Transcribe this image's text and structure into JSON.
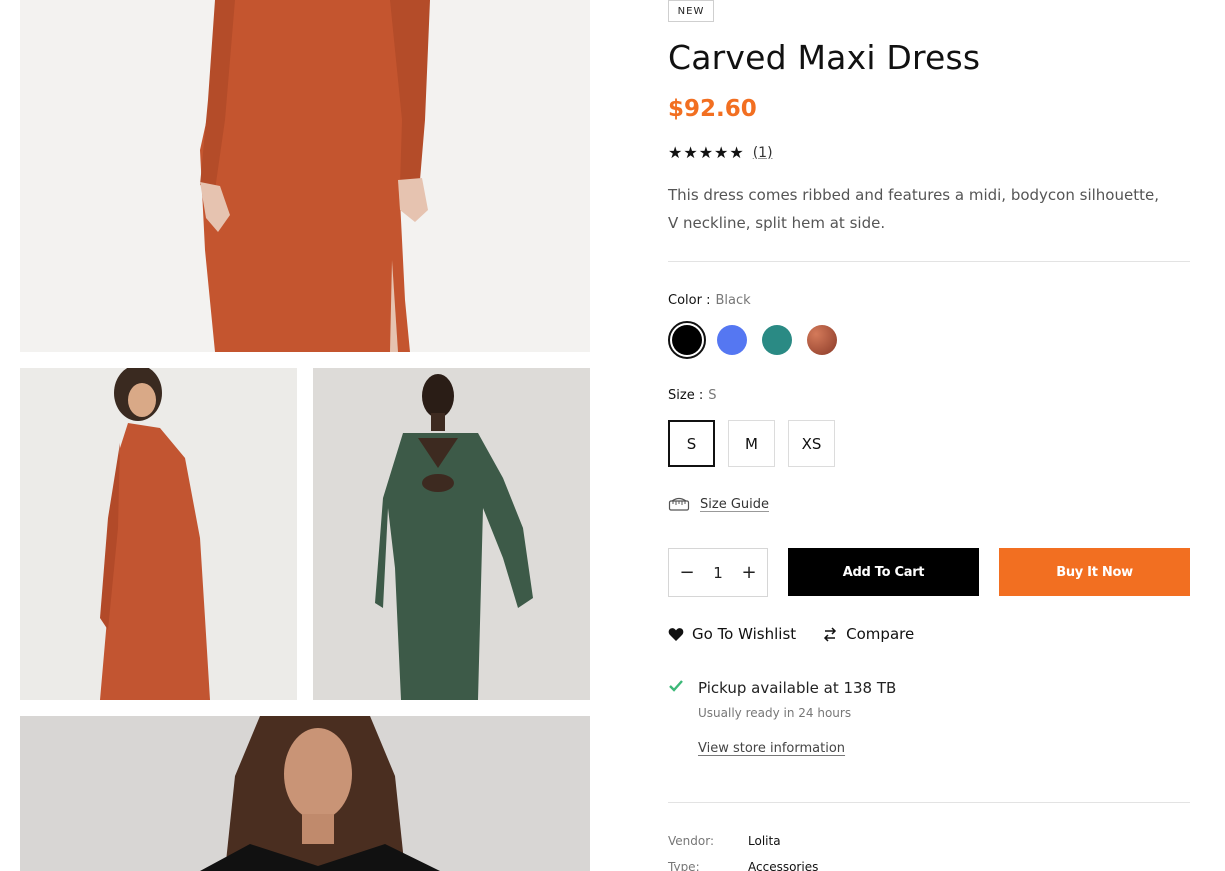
{
  "badge": "NEW",
  "product": {
    "title": "Carved Maxi Dress",
    "price": "$92.60",
    "stars": "★★★★★",
    "review_count": "(1)",
    "description": "This dress comes ribbed and features a midi, bodycon silhouette, V neckline, split hem at side."
  },
  "color": {
    "label": "Color :",
    "selected": "Black",
    "swatches": [
      {
        "name": "Black",
        "hex": "#000000"
      },
      {
        "name": "Blue",
        "hex": "#5577f2"
      },
      {
        "name": "Teal",
        "hex": "#2a8a84"
      },
      {
        "name": "Rust",
        "hex": "#9b4a36"
      }
    ]
  },
  "size": {
    "label": "Size :",
    "selected": "S",
    "options": [
      "S",
      "M",
      "XS"
    ]
  },
  "size_guide": "Size Guide",
  "quantity": {
    "value": "1",
    "minus": "−",
    "plus": "+"
  },
  "buttons": {
    "add_to_cart": "Add To Cart",
    "buy_now": "Buy It Now"
  },
  "actions": {
    "wishlist": "Go To Wishlist",
    "compare": "Compare"
  },
  "pickup": {
    "text": "Pickup available at 138 TB",
    "ready": "Usually ready in 24 hours",
    "store_link": "View store information"
  },
  "meta": {
    "vendor_label": "Vendor:",
    "vendor": "Lolita",
    "type_label": "Type:",
    "type": "Accessories"
  },
  "colors": {
    "accent": "#f26f21",
    "check": "#3cb878"
  },
  "icons": [
    "size-guide-icon",
    "heart-icon",
    "compare-icon",
    "check-icon",
    "minus-icon",
    "plus-icon"
  ]
}
